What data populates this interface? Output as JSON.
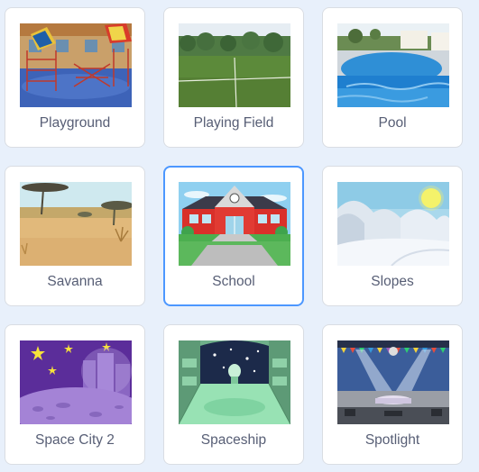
{
  "backdrops": [
    {
      "label": "Playground"
    },
    {
      "label": "Playing Field"
    },
    {
      "label": "Pool"
    },
    {
      "label": "Savanna"
    },
    {
      "label": "School",
      "selected": true
    },
    {
      "label": "Slopes"
    },
    {
      "label": "Space City 2"
    },
    {
      "label": "Spaceship"
    },
    {
      "label": "Spotlight"
    }
  ],
  "colors": {
    "page_bg": "#e8f0fb",
    "card_border": "#d9dde3",
    "selected_border": "#4c97ff",
    "label_text": "#575e75"
  }
}
